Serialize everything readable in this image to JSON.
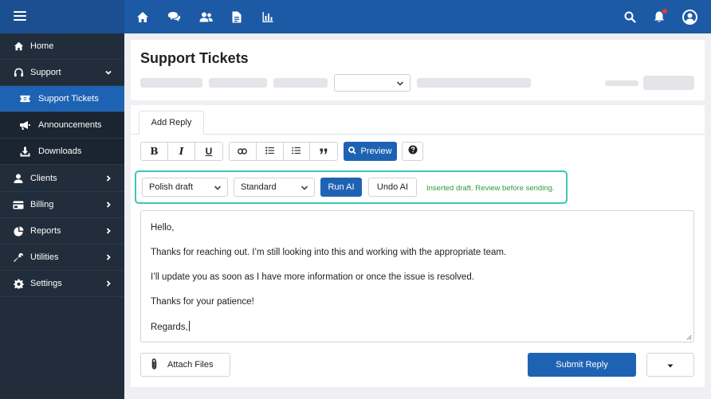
{
  "sidebar": {
    "items": [
      {
        "label": "Home",
        "icon": "home-icon"
      },
      {
        "label": "Support",
        "icon": "headset-icon"
      },
      {
        "label": "Support Tickets",
        "icon": "ticket-icon"
      },
      {
        "label": "Announcements",
        "icon": "megaphone-icon"
      },
      {
        "label": "Downloads",
        "icon": "download-icon"
      },
      {
        "label": "Clients",
        "icon": "user-icon"
      },
      {
        "label": "Billing",
        "icon": "credit-card-icon"
      },
      {
        "label": "Reports",
        "icon": "pie-chart-icon"
      },
      {
        "label": "Utilities",
        "icon": "wrench-icon"
      },
      {
        "label": "Settings",
        "icon": "gear-icon"
      }
    ]
  },
  "header": {
    "title": "Support Tickets"
  },
  "tabs": [
    {
      "label": "Add Reply"
    }
  ],
  "toolbar": {
    "bold": "B",
    "italic": "I",
    "underline": "U",
    "preview_label": "Preview"
  },
  "ai": {
    "mode_selected": "Polish draft",
    "tone_selected": "Standard",
    "run_label": "Run AI",
    "undo_label": "Undo AI",
    "status": "Inserted draft. Review before sending.",
    "status_color": "#2e9a3e",
    "highlight_color": "#3dc6b6"
  },
  "editor": {
    "lines": [
      "Hello,",
      "Thanks for reaching out. I’m still looking into this and working with the appropriate team.",
      "I’ll update you as soon as I have more information or once the issue is resolved.",
      "Thanks for your patience!",
      "Regards,"
    ]
  },
  "actions": {
    "attach_label": "Attach Files",
    "submit_label": "Submit Reply"
  },
  "colors": {
    "topbar": "#1c5aa6",
    "sidebar": "#212d3b",
    "accent": "#1e63b3",
    "notification": "#e53935"
  }
}
